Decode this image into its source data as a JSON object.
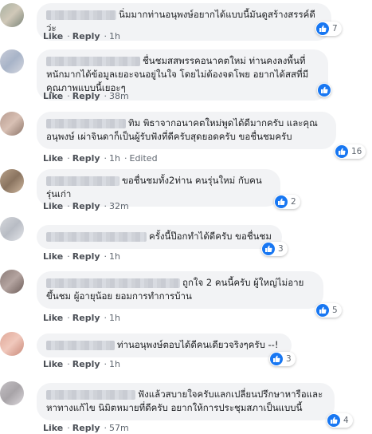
{
  "actions": {
    "like": "Like",
    "reply": "Reply",
    "separator": "·",
    "edited": "Edited"
  },
  "colors": {
    "like_blue": "#1877f2",
    "bubble_bg": "#f2f3f5",
    "meta_gray": "#606770"
  },
  "comments": [
    {
      "text": "นิ่มมากท่านอนุพงษ์อยากได้แบบนี้มันดูสร้างสรรค์ดีว่ะ",
      "time": "1h",
      "likes": "7"
    },
    {
      "text": "ชื่นชมสสพรรคอนาคตใหม่ ท่านคงลงพื้นที่หนักมากได้ข้อมูลเยอะจนอยู่ในใจ โดยไม่ต้องจดโพย อยากได้สสที่มีคุณภาพแบบนี้เยอะๆ",
      "time": "38m",
      "likes": ""
    },
    {
      "text": "ทิม พิธาจากอนาคตใหม่พูดได้ดีมากครับ และคุณอนุพงษ์ เผ่าจินดาก็เป็นผู้รับฟังที่ดีครับสุดยอดครับ ขอชื่นชมครับ",
      "time": "1h",
      "likes": "16",
      "edited": true
    },
    {
      "text": "ขอชื่นชมทั้ง2ท่าน คนรุ่นใหม่ กับคนรุ่นเก่า",
      "time": "32m",
      "likes": "2"
    },
    {
      "text": "ครั้งนี้ป๊อกทำได้ดีครับ ขอชื่นชม",
      "time": "1h",
      "likes": "3"
    },
    {
      "text": "ถูกใจ 2 คนนี้ครับ ผู้ใหญ่ไม่อายขึ้นชม ผู้อายุน้อย ยอมการทำการบ้าน",
      "time": "1h",
      "likes": "5"
    },
    {
      "text": "ท่านอนุพงษ์ตอบได้ดีคนเดียวจริงๆครับ --!",
      "time": "1h",
      "likes": "3"
    },
    {
      "text": "ฟังแล้วสบายใจครับแลกเปลี่ยนปรึกษาหารือและหาทางแก้ไข นิมิตหมายที่ดีครับ อยากให้การประชุมสภาเป็นแบบนี้",
      "time": "57m",
      "likes": "4"
    }
  ]
}
